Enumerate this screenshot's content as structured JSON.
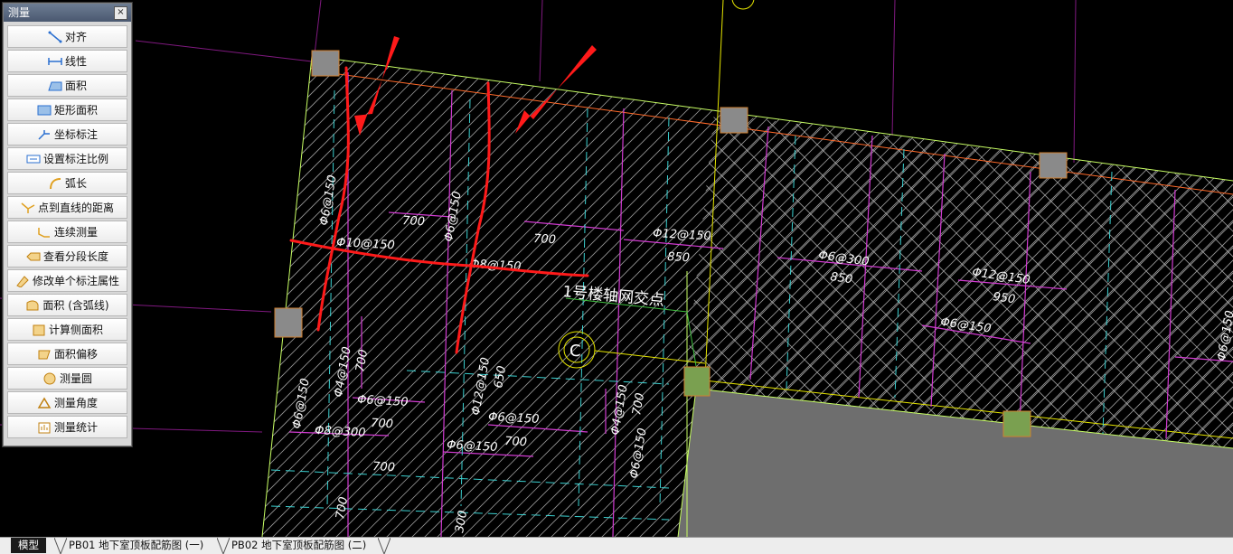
{
  "panel": {
    "title": "测量",
    "close": "×",
    "tools": [
      {
        "id": "align",
        "label": "对齐",
        "icon": "align-icon"
      },
      {
        "id": "linear",
        "label": "线性",
        "icon": "linear-dim-icon"
      },
      {
        "id": "area",
        "label": "面积",
        "icon": "area-icon"
      },
      {
        "id": "rect-area",
        "label": "矩形面积",
        "icon": "rect-area-icon"
      },
      {
        "id": "coord",
        "label": "坐标标注",
        "icon": "coordinate-icon"
      },
      {
        "id": "scale",
        "label": "设置标注比例",
        "icon": "scale-icon"
      },
      {
        "id": "arc",
        "label": "弧长",
        "icon": "arc-length-icon"
      },
      {
        "id": "point-line",
        "label": "点到直线的距离",
        "icon": "point-to-line-icon"
      },
      {
        "id": "continuous",
        "label": "连续测量",
        "icon": "continuous-measure-icon"
      },
      {
        "id": "segment",
        "label": "查看分段长度",
        "icon": "segment-length-icon"
      },
      {
        "id": "modify",
        "label": "修改单个标注属性",
        "icon": "modify-dim-icon"
      },
      {
        "id": "area-arc",
        "label": "面积 (含弧线)",
        "icon": "area-arc-icon"
      },
      {
        "id": "side-area",
        "label": "计算侧面积",
        "icon": "side-area-icon"
      },
      {
        "id": "area-offset",
        "label": "面积偏移",
        "icon": "area-offset-icon"
      },
      {
        "id": "circle",
        "label": "测量圆",
        "icon": "measure-circle-icon"
      },
      {
        "id": "angle",
        "label": "测量角度",
        "icon": "measure-angle-icon"
      },
      {
        "id": "stats",
        "label": "测量统计",
        "icon": "measure-stats-icon"
      }
    ]
  },
  "drawing": {
    "annotation": "1号楼轴网交点",
    "labels": [
      "Φ6@150",
      "Φ10@150",
      "700",
      "Φ6@150",
      "700",
      "Φ8@150",
      "Φ12@150",
      "850",
      "Φ6@300",
      "850",
      "Φ12@150",
      "950",
      "Φ6@150",
      "Φ4@150",
      "700",
      "Φ6@150",
      "Φ12@150",
      "650",
      "Φ6@150",
      "700",
      "Φ6@150",
      "Φ8@300",
      "700",
      "Φ6@150",
      "700",
      "Φ4@150",
      "700",
      "Φ6@150",
      "700",
      "300",
      "Φ6@150"
    ]
  },
  "tabs": [
    "模型",
    "PB01 地下室顶板配筋图 (一)",
    "PB02 地下室顶板配筋图 (二)"
  ],
  "colors": {
    "background": "#000000",
    "hatch": "#8a8a8a",
    "slab_border": "#c8ff64",
    "magenta": "#d23cd2",
    "cyan": "#3cd2d2",
    "red_markup": "#ff1a1a",
    "yellow": "#e6e600",
    "gray_fill": "#6e6e6e"
  }
}
